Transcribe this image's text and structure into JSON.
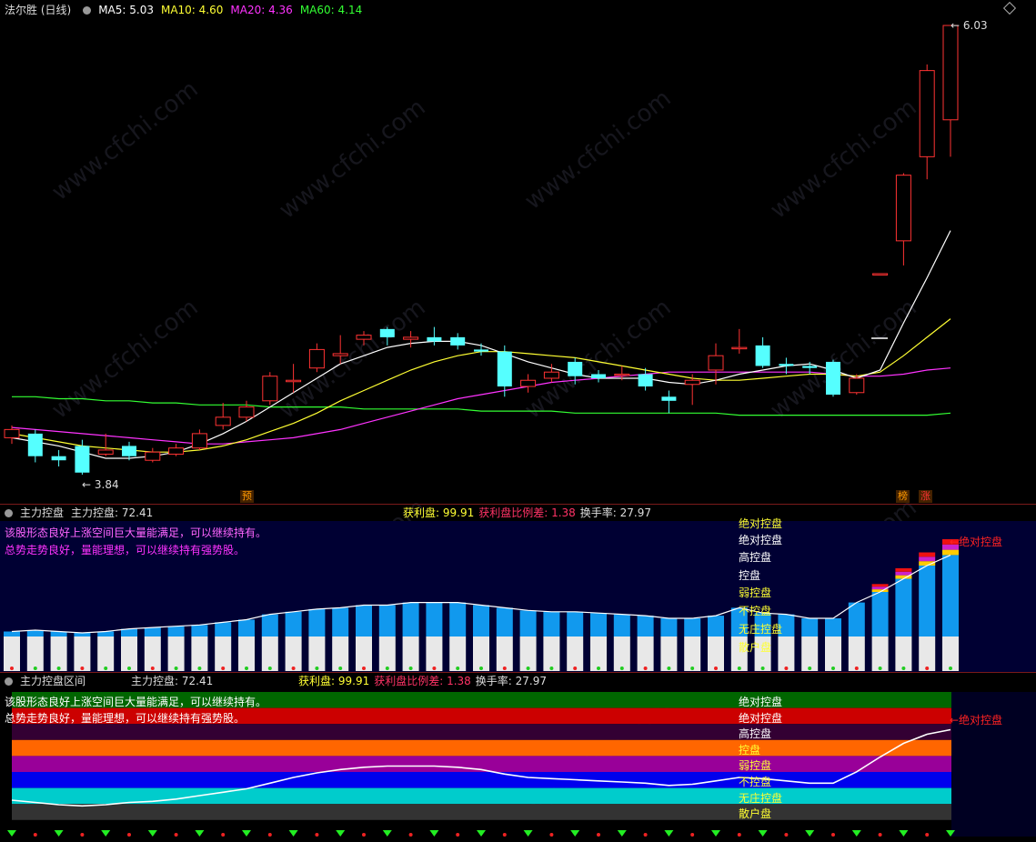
{
  "main_pane": {
    "title": "法尔胜 (日线)",
    "ma5_label": "MA5: 5.03",
    "ma10_label": "MA10: 4.60",
    "ma20_label": "MA20: 4.36",
    "ma60_label": "MA60: 4.14",
    "high_label": "6.03",
    "low_label": "3.84",
    "tag_pre": "预",
    "tag_rank": "榜",
    "tag_up": "涨",
    "colors": {
      "ma5": "#ffffff",
      "ma10": "#ffff33",
      "ma20": "#ff33ff",
      "ma60": "#33ff33",
      "up": "#ff3333",
      "down": "#55ffff"
    }
  },
  "pane2": {
    "title": "主力控盘",
    "ctrl_label": "主力控盘: 72.41",
    "profit_label": "获利盘: 99.91",
    "ratio_label": "获利盘比例差: 1.38",
    "turnover_label": "换手率: 27.97",
    "msg1": "该股形态良好上涨空间巨大量能满足，可以继续持有。",
    "msg2": "总势走势良好，量能理想，可以继续持有强势股。",
    "levels": [
      "绝对控盘",
      "绝对控盘",
      "高控盘",
      "控盘",
      "弱控盘",
      "不控盘",
      "无庄控盘",
      "散户盘"
    ],
    "arrow_label": "←绝对控盘"
  },
  "pane3": {
    "title": "主力控盘区间",
    "ctrl_label": "主力控盘: 72.41",
    "profit_label": "获利盘: 99.91",
    "ratio_label": "获利盘比例差: 1.38",
    "turnover_label": "换手率: 27.97",
    "msg1": "该股形态良好上涨空间巨大量能满足，可以继续持有。",
    "msg2": "总势走势良好，量能理想，可以继续持有强势股。",
    "levels": [
      "绝对控盘",
      "绝对控盘",
      "高控盘",
      "控盘",
      "弱控盘",
      "不控盘",
      "无庄控盘",
      "散户盘"
    ],
    "arrow_label": "←绝对控盘",
    "band_colors": [
      "#006600",
      "#cc0000",
      "#330033",
      "#ff6600",
      "#990099",
      "#0000ee",
      "#00cccc",
      "#333333"
    ]
  },
  "chart_data": {
    "type": "candlestick",
    "candles": [
      [
        4.02,
        4.06,
        4.08,
        3.99
      ],
      [
        4.04,
        3.93,
        4.06,
        3.9
      ],
      [
        3.93,
        3.91,
        3.96,
        3.88
      ],
      [
        3.98,
        3.85,
        4.01,
        3.84
      ],
      [
        3.94,
        3.96,
        4.04,
        3.93
      ],
      [
        3.98,
        3.93,
        4.0,
        3.91
      ],
      [
        3.91,
        3.95,
        3.97,
        3.9
      ],
      [
        3.94,
        3.97,
        3.99,
        3.93
      ],
      [
        3.97,
        4.04,
        4.06,
        3.96
      ],
      [
        4.08,
        4.12,
        4.19,
        4.06
      ],
      [
        4.12,
        4.17,
        4.2,
        4.1
      ],
      [
        4.2,
        4.32,
        4.34,
        4.18
      ],
      [
        4.3,
        4.3,
        4.38,
        4.24
      ],
      [
        4.36,
        4.45,
        4.48,
        4.34
      ],
      [
        4.42,
        4.43,
        4.52,
        4.38
      ],
      [
        4.5,
        4.52,
        4.54,
        4.47
      ],
      [
        4.55,
        4.51,
        4.56,
        4.47
      ],
      [
        4.5,
        4.51,
        4.54,
        4.46
      ],
      [
        4.51,
        4.49,
        4.56,
        4.47
      ],
      [
        4.51,
        4.47,
        4.53,
        4.45
      ],
      [
        4.45,
        4.44,
        4.48,
        4.42
      ],
      [
        4.44,
        4.27,
        4.47,
        4.22
      ],
      [
        4.27,
        4.3,
        4.33,
        4.24
      ],
      [
        4.31,
        4.34,
        4.38,
        4.29
      ],
      [
        4.39,
        4.32,
        4.41,
        4.28
      ],
      [
        4.33,
        4.31,
        4.35,
        4.29
      ],
      [
        4.33,
        4.33,
        4.37,
        4.3
      ],
      [
        4.33,
        4.27,
        4.36,
        4.25
      ],
      [
        4.22,
        4.2,
        4.25,
        4.14
      ],
      [
        4.28,
        4.3,
        4.33,
        4.18
      ],
      [
        4.35,
        4.42,
        4.48,
        4.28
      ],
      [
        4.46,
        4.46,
        4.55,
        4.43
      ],
      [
        4.47,
        4.37,
        4.51,
        4.36
      ],
      [
        4.38,
        4.37,
        4.41,
        4.33
      ],
      [
        4.37,
        4.36,
        4.39,
        4.33
      ],
      [
        4.39,
        4.23,
        4.4,
        4.22
      ],
      [
        4.24,
        4.31,
        4.33,
        4.23
      ],
      [
        4.82,
        4.82,
        4.82,
        4.82
      ],
      [
        4.98,
        5.3,
        5.31,
        4.86
      ],
      [
        5.39,
        5.81,
        5.84,
        5.28
      ],
      [
        5.57,
        6.03,
        6.03,
        5.39
      ]
    ],
    "ma5": [
      4.02,
      4.0,
      3.98,
      3.95,
      3.92,
      3.92,
      3.93,
      3.95,
      3.99,
      4.04,
      4.1,
      4.17,
      4.24,
      4.31,
      4.38,
      4.42,
      4.46,
      4.48,
      4.49,
      4.49,
      4.47,
      4.43,
      4.39,
      4.36,
      4.33,
      4.31,
      4.31,
      4.31,
      4.29,
      4.28,
      4.3,
      4.33,
      4.35,
      4.37,
      4.38,
      4.35,
      4.31,
      4.35,
      4.58,
      4.8,
      5.03
    ],
    "ma10": [
      4.04,
      4.02,
      4.0,
      3.98,
      3.97,
      3.96,
      3.95,
      3.95,
      3.96,
      3.98,
      4.01,
      4.05,
      4.09,
      4.14,
      4.2,
      4.25,
      4.3,
      4.35,
      4.39,
      4.42,
      4.44,
      4.44,
      4.43,
      4.42,
      4.41,
      4.39,
      4.37,
      4.35,
      4.33,
      4.31,
      4.3,
      4.3,
      4.31,
      4.32,
      4.33,
      4.33,
      4.32,
      4.34,
      4.42,
      4.51,
      4.6
    ],
    "ma20": [
      4.07,
      4.06,
      4.05,
      4.04,
      4.03,
      4.02,
      4.01,
      4.0,
      3.99,
      3.99,
      4.0,
      4.01,
      4.02,
      4.04,
      4.06,
      4.09,
      4.12,
      4.15,
      4.18,
      4.21,
      4.23,
      4.25,
      4.27,
      4.29,
      4.3,
      4.31,
      4.32,
      4.33,
      4.34,
      4.34,
      4.34,
      4.34,
      4.34,
      4.34,
      4.34,
      4.33,
      4.32,
      4.32,
      4.33,
      4.35,
      4.36
    ],
    "ma60": [
      4.22,
      4.22,
      4.21,
      4.21,
      4.2,
      4.2,
      4.19,
      4.19,
      4.18,
      4.18,
      4.18,
      4.17,
      4.17,
      4.17,
      4.17,
      4.16,
      4.16,
      4.16,
      4.16,
      4.16,
      4.15,
      4.15,
      4.15,
      4.15,
      4.14,
      4.14,
      4.14,
      4.14,
      4.14,
      4.14,
      4.14,
      4.13,
      4.13,
      4.13,
      4.13,
      4.13,
      4.13,
      4.13,
      4.13,
      4.13,
      4.14
    ],
    "y_high": 6.03,
    "y_low": 3.84,
    "control_bars": {
      "base": [
        30,
        31,
        30,
        29,
        30,
        32,
        33,
        34,
        35,
        37,
        39,
        43,
        45,
        47,
        48,
        50,
        50,
        52,
        52,
        52,
        50,
        48,
        46,
        45,
        45,
        44,
        43,
        42,
        40,
        40,
        42,
        48,
        44,
        43,
        40,
        40,
        52,
        60,
        70,
        80,
        88
      ],
      "top": [
        30,
        31,
        30,
        29,
        30,
        32,
        33,
        34,
        35,
        37,
        39,
        43,
        45,
        47,
        48,
        50,
        50,
        52,
        52,
        52,
        50,
        48,
        46,
        45,
        45,
        44,
        43,
        42,
        40,
        40,
        42,
        48,
        44,
        43,
        40,
        40,
        52,
        66,
        78,
        90,
        100
      ]
    },
    "control_line": [
      20,
      18,
      16,
      15,
      16,
      18,
      19,
      21,
      24,
      27,
      30,
      35,
      40,
      44,
      47,
      49,
      50,
      50,
      50,
      49,
      47,
      43,
      40,
      39,
      38,
      37,
      36,
      35,
      33,
      34,
      37,
      40,
      39,
      37,
      35,
      35,
      45,
      58,
      70,
      78,
      82
    ]
  }
}
